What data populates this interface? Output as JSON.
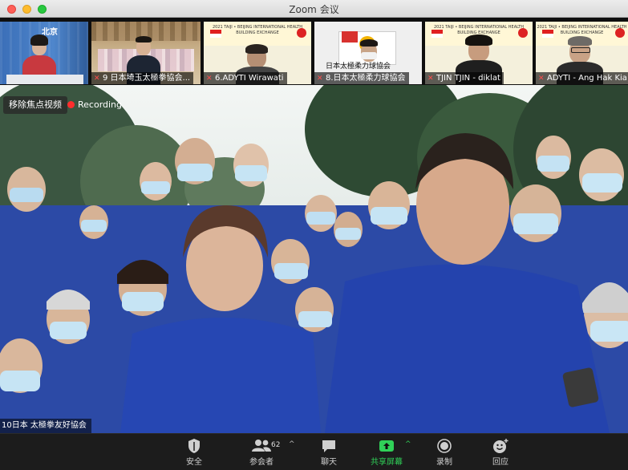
{
  "window": {
    "title": "Zoom 会议"
  },
  "thumbnails": [
    {
      "id": "beijing",
      "name": "",
      "corner_label": "北京",
      "banner_text": "",
      "mic_muted": false
    },
    {
      "id": "saitama",
      "name": "9 日本埼玉太極拳協会...",
      "banner_text": "",
      "mic_muted": true
    },
    {
      "id": "adyti6",
      "name": "6.ADYTI Wirawati",
      "banner_text": "2021 TAIJI • BEIJING INTERNATIONAL HEALTH BUILDING EXCHANGE",
      "mic_muted": true
    },
    {
      "id": "jouryoku",
      "name": "8.日本太極柔力球協会",
      "banner_text": "日本太極柔力球協会",
      "mic_muted": true
    },
    {
      "id": "tjin",
      "name": "TJIN TJIN - diklat",
      "banner_text": "2021 TAIJI • BEIJING INTERNATIONAL HEALTH BUILDING EXCHANGE",
      "mic_muted": true
    },
    {
      "id": "angkia",
      "name": "ADYTI - Ang Hak Kia",
      "banner_text": "2021 TAIJI • BEIJING INTERNATIONAL HEALTH BUILDING EXCHANGE",
      "mic_muted": true
    }
  ],
  "main_video": {
    "remove_focus_label": "移除焦点视频",
    "recording_label": "Recording",
    "speaker_name": "10日本 太極拳友好協会"
  },
  "toolbar": {
    "security": {
      "label": "安全",
      "icon": "shield-icon"
    },
    "participants": {
      "label": "参会者",
      "count": "62",
      "icon": "participants-icon"
    },
    "chat": {
      "label": "聊天",
      "icon": "chat-icon"
    },
    "share": {
      "label": "共享屏幕",
      "icon": "share-screen-icon",
      "color": "#30d158"
    },
    "record": {
      "label": "录制",
      "icon": "record-icon"
    },
    "reactions": {
      "label": "回应",
      "icon": "reaction-icon"
    }
  }
}
